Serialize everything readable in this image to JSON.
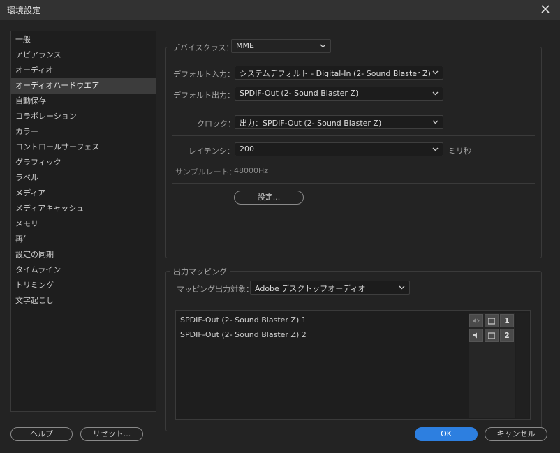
{
  "window": {
    "title": "環境設定"
  },
  "sidebar": {
    "items": [
      {
        "label": "一般",
        "selected": false
      },
      {
        "label": "アピアランス",
        "selected": false
      },
      {
        "label": "オーディオ",
        "selected": false
      },
      {
        "label": "オーディオハードウエア",
        "selected": true
      },
      {
        "label": "自動保存",
        "selected": false
      },
      {
        "label": "コラボレーション",
        "selected": false
      },
      {
        "label": "カラー",
        "selected": false
      },
      {
        "label": "コントロールサーフェス",
        "selected": false
      },
      {
        "label": "グラフィック",
        "selected": false
      },
      {
        "label": "ラベル",
        "selected": false
      },
      {
        "label": "メディア",
        "selected": false
      },
      {
        "label": "メディアキャッシュ",
        "selected": false
      },
      {
        "label": "メモリ",
        "selected": false
      },
      {
        "label": "再生",
        "selected": false
      },
      {
        "label": "設定の同期",
        "selected": false
      },
      {
        "label": "タイムライン",
        "selected": false
      },
      {
        "label": "トリミング",
        "selected": false
      },
      {
        "label": "文字起こし",
        "selected": false
      }
    ]
  },
  "device": {
    "class_label": "デバイスクラス：",
    "class_value": "MME",
    "default_input_label": "デフォルト入力：",
    "default_input_value": "システムデフォルト  - Digital-In (2- Sound Blaster Z)",
    "default_output_label": "デフォルト出力：",
    "default_output_value": "SPDIF-Out (2- Sound Blaster Z)",
    "clock_label": "クロック：",
    "clock_value": "出力：SPDIF-Out (2- Sound Blaster Z)",
    "latency_label": "レイテンシ：",
    "latency_value": "200",
    "latency_unit": "ミリ秒",
    "sample_rate_label": "サンプルレート：",
    "sample_rate_value": "48000Hz",
    "settings_button": "設定..."
  },
  "mapping": {
    "section_title": "出力マッピング",
    "target_label": "マッピング出力対象：",
    "target_value": "Adobe デスクトップオーディオ",
    "rows": [
      {
        "label": "SPDIF-Out (2- Sound Blaster Z) 1",
        "channel": "1"
      },
      {
        "label": "SPDIF-Out (2- Sound Blaster Z) 2",
        "channel": "2"
      }
    ]
  },
  "footer": {
    "help": "ヘルプ",
    "reset": "リセット...",
    "ok": "OK",
    "cancel": "キャンセル"
  },
  "colors": {
    "accent": "#2d7fe0",
    "background": "#232323",
    "titlebar": "#323232"
  },
  "icons": [
    "close-icon",
    "chevron-down-icon",
    "speaker-icon",
    "frame-icon"
  ]
}
